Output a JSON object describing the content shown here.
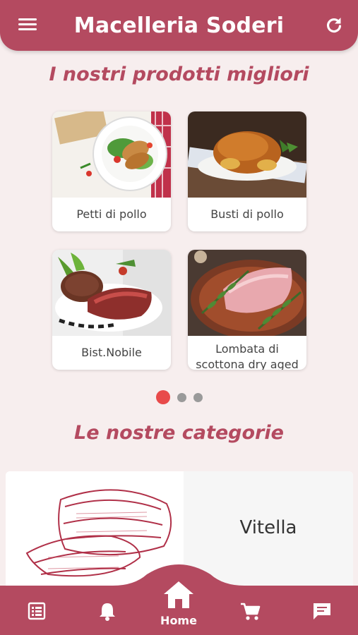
{
  "header": {
    "title": "Macelleria Soderi",
    "menu_icon": "hamburger-menu-icon",
    "refresh_icon": "refresh-icon",
    "color": "#b44a60"
  },
  "products_section": {
    "title": "I nostri prodotti migliori",
    "items": [
      {
        "label": "Petti di pollo",
        "image": "grilled-chicken-breast-salad"
      },
      {
        "label": "Busti di pollo",
        "image": "roast-chicken"
      },
      {
        "label": "Bist.Nobile",
        "image": "sliced-steak-with-salad"
      },
      {
        "label": "Lombata di scottona dry aged",
        "image": "raw-loin-with-rosemary"
      }
    ],
    "pagination": {
      "pages": 3,
      "active": 1,
      "active_color": "#e84a4a"
    }
  },
  "categories_section": {
    "title": "Le nostre categorie",
    "items": [
      {
        "label": "Vitella",
        "image": "meat-cut-sketch"
      }
    ]
  },
  "bottom_nav": {
    "items": [
      {
        "icon": "list-icon",
        "label": ""
      },
      {
        "icon": "bell-icon",
        "label": ""
      },
      {
        "icon": "home-icon",
        "label": "Home"
      },
      {
        "icon": "cart-icon",
        "label": ""
      },
      {
        "icon": "chat-icon",
        "label": ""
      }
    ],
    "active": "Home"
  }
}
